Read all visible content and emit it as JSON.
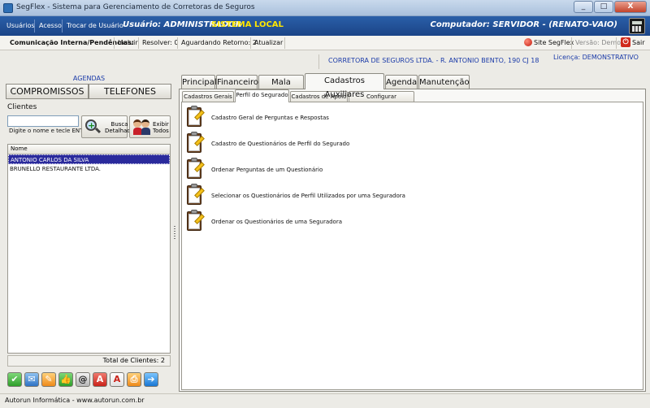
{
  "window": {
    "title": "SegFlex - Sistema para Gerenciamento de Corretoras de Seguros",
    "minimize": "_",
    "maximize": "□",
    "close": "X"
  },
  "menubar": {
    "items": [
      "Usuários",
      "Acesso",
      "Trocar de Usuário"
    ],
    "user": "Usuário: ADMINISTRADOR",
    "mode": "SISTEMA LOCAL",
    "computer": "Computador: SERVIDOR - (RENATO-VAIO)"
  },
  "toolbar": {
    "title": "Comunicação Interna/Pendências:",
    "incluir": "Incluir",
    "resolver": "Resolver: 0",
    "aguardando": "Aguardando Retorno: 2",
    "atualizar": "Atualizar",
    "site": "Site SegFlex",
    "versao": "Versão: Demo",
    "sair": "Sair"
  },
  "info": {
    "company": "CORRETORA DE SEGUROS LTDA. - R. ANTONIO BENTO, 190 CJ 18",
    "license": "Licença: DEMONSTRATIVO"
  },
  "left": {
    "agendas": "AGENDAS",
    "tabs": [
      "COMPROMISSOS",
      "TELEFONES"
    ],
    "clientes_label": "Clientes",
    "search_hint": "Digite o nome e tecle ENTER",
    "search_value": "",
    "busca_btn": [
      "Busca",
      "Detalhada"
    ],
    "exibir_btn": [
      "Exibir",
      "Todos"
    ],
    "grid_header": "Nome",
    "rows": [
      "ANTONIO CARLOS DA SILVA",
      "BRUNELLO RESTAURANTE LTDA."
    ],
    "total": "Total de Clientes: 2",
    "actions": [
      {
        "icon": "check-icon",
        "glyph": "✔"
      },
      {
        "icon": "mail-icon",
        "glyph": "✉"
      },
      {
        "icon": "edit-icon",
        "glyph": "✎"
      },
      {
        "icon": "thumbs-up-icon",
        "glyph": "👍"
      },
      {
        "icon": "at-icon",
        "glyph": "@"
      },
      {
        "icon": "letter-a-icon",
        "glyph": "A"
      },
      {
        "icon": "letter-a-small-icon",
        "glyph": "A"
      },
      {
        "icon": "print-icon",
        "glyph": "⎙"
      },
      {
        "icon": "arrow-right-icon",
        "glyph": "➔"
      }
    ]
  },
  "main": {
    "tabs": [
      "Principal",
      "Financeiro",
      "Mala Direta",
      "Cadastros Auxiliares",
      "Agenda",
      "Manutenção"
    ],
    "active_tab": "Cadastros Auxiliares",
    "subtabs": [
      "Cadastros Gerais",
      "Perfil do Segurado",
      "Cadastros de Apoio",
      "Configurar Importação"
    ],
    "active_subtab": "Perfil do Segurado",
    "items": [
      "Cadastro Geral de Perguntas e Respostas",
      "Cadastro de Questionários de Perfil do Segurado",
      "Ordenar Perguntas de um Questionário",
      "Selecionar os Questionários de Perfil Utilizados por uma Seguradora",
      "Ordenar os Questionários de uma Seguradora"
    ]
  },
  "status": {
    "text": "Autorun Informática - www.autorun.com.br"
  }
}
